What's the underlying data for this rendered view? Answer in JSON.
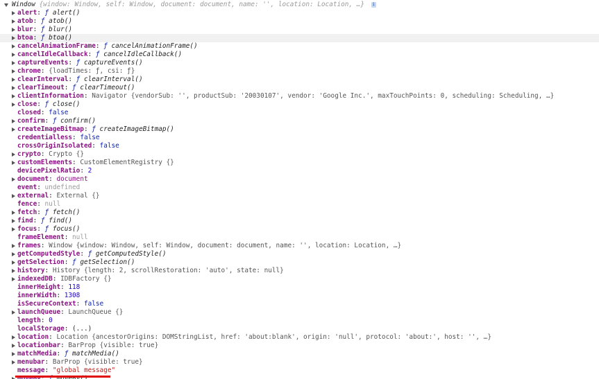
{
  "header": {
    "type": "Window",
    "preview": "{window: Window, self: Window, document: document, name: '', location: Location, …}",
    "info_icon": "i"
  },
  "properties": [
    {
      "key": "alert",
      "sep": ": ",
      "fk": "ƒ",
      "val": " alert()",
      "kind": "fn",
      "expand": true
    },
    {
      "key": "atob",
      "sep": ": ",
      "fk": "ƒ",
      "val": " atob()",
      "kind": "fn",
      "expand": true
    },
    {
      "key": "blur",
      "sep": ": ",
      "fk": "ƒ",
      "val": " blur()",
      "kind": "fn",
      "expand": true
    },
    {
      "key": "btoa",
      "sep": ": ",
      "fk": "ƒ",
      "val": " btoa()",
      "kind": "fn",
      "expand": true,
      "highlight": true
    },
    {
      "key": "cancelAnimationFrame",
      "sep": ": ",
      "fk": "ƒ",
      "val": " cancelAnimationFrame()",
      "kind": "fn",
      "expand": true
    },
    {
      "key": "cancelIdleCallback",
      "sep": ": ",
      "fk": "ƒ",
      "val": " cancelIdleCallback()",
      "kind": "fn",
      "expand": true
    },
    {
      "key": "captureEvents",
      "sep": ": ",
      "fk": "ƒ",
      "val": " captureEvents()",
      "kind": "fn",
      "expand": true
    },
    {
      "key": "chrome",
      "sep": ": ",
      "val": "{loadTimes: ƒ, csi: ƒ}",
      "kind": "obj",
      "expand": true
    },
    {
      "key": "clearInterval",
      "sep": ": ",
      "fk": "ƒ",
      "val": " clearInterval()",
      "kind": "fn",
      "expand": true
    },
    {
      "key": "clearTimeout",
      "sep": ": ",
      "fk": "ƒ",
      "val": " clearTimeout()",
      "kind": "fn",
      "expand": true
    },
    {
      "key": "clientInformation",
      "sep": ": ",
      "val": "Navigator {vendorSub: '', productSub: '20030107', vendor: 'Google Inc.', maxTouchPoints: 0, scheduling: Scheduling, …}",
      "kind": "obj",
      "expand": true
    },
    {
      "key": "close",
      "sep": ": ",
      "fk": "ƒ",
      "val": " close()",
      "kind": "fn",
      "expand": true
    },
    {
      "key": "closed",
      "sep": ": ",
      "val": "false",
      "kind": "bool",
      "expand": false
    },
    {
      "key": "confirm",
      "sep": ": ",
      "fk": "ƒ",
      "val": " confirm()",
      "kind": "fn",
      "expand": true
    },
    {
      "key": "createImageBitmap",
      "sep": ": ",
      "fk": "ƒ",
      "val": " createImageBitmap()",
      "kind": "fn",
      "expand": true
    },
    {
      "key": "credentialless",
      "sep": ": ",
      "val": "false",
      "kind": "bool",
      "expand": false
    },
    {
      "key": "crossOriginIsolated",
      "sep": ": ",
      "val": "false",
      "kind": "bool",
      "expand": false
    },
    {
      "key": "crypto",
      "sep": ": ",
      "val": "Crypto {}",
      "kind": "obj",
      "expand": true
    },
    {
      "key": "customElements",
      "sep": ": ",
      "val": "CustomElementRegistry {}",
      "kind": "obj",
      "expand": true
    },
    {
      "key": "devicePixelRatio",
      "sep": ": ",
      "val": "2",
      "kind": "num",
      "expand": false
    },
    {
      "key": "document",
      "sep": ": ",
      "val": "document",
      "kind": "docref",
      "expand": true
    },
    {
      "key": "event",
      "sep": ": ",
      "val": "undefined",
      "kind": "undef",
      "expand": false
    },
    {
      "key": "external",
      "sep": ": ",
      "val": "External {}",
      "kind": "obj",
      "expand": true
    },
    {
      "key": "fence",
      "sep": ": ",
      "val": "null",
      "kind": "undef",
      "expand": false
    },
    {
      "key": "fetch",
      "sep": ": ",
      "fk": "ƒ",
      "val": " fetch()",
      "kind": "fn",
      "expand": true
    },
    {
      "key": "find",
      "sep": ": ",
      "fk": "ƒ",
      "val": " find()",
      "kind": "fn",
      "expand": true
    },
    {
      "key": "focus",
      "sep": ": ",
      "fk": "ƒ",
      "val": " focus()",
      "kind": "fn",
      "expand": true
    },
    {
      "key": "frameElement",
      "sep": ": ",
      "val": "null",
      "kind": "undef",
      "expand": false
    },
    {
      "key": "frames",
      "sep": ": ",
      "val": "Window {window: Window, self: Window, document: document, name: '', location: Location, …}",
      "kind": "obj",
      "expand": true
    },
    {
      "key": "getComputedStyle",
      "sep": ": ",
      "fk": "ƒ",
      "val": " getComputedStyle()",
      "kind": "fn",
      "expand": true
    },
    {
      "key": "getSelection",
      "sep": ": ",
      "fk": "ƒ",
      "val": " getSelection()",
      "kind": "fn",
      "expand": true
    },
    {
      "key": "history",
      "sep": ": ",
      "val": "History {length: 2, scrollRestoration: 'auto', state: null}",
      "kind": "obj",
      "expand": true
    },
    {
      "key": "indexedDB",
      "sep": ": ",
      "val": "IDBFactory {}",
      "kind": "obj",
      "expand": true
    },
    {
      "key": "innerHeight",
      "sep": ": ",
      "val": "118",
      "kind": "num",
      "expand": false
    },
    {
      "key": "innerWidth",
      "sep": ": ",
      "val": "1308",
      "kind": "num",
      "expand": false
    },
    {
      "key": "isSecureContext",
      "sep": ": ",
      "val": "false",
      "kind": "bool",
      "expand": false
    },
    {
      "key": "launchQueue",
      "sep": ": ",
      "val": "LaunchQueue {}",
      "kind": "obj",
      "expand": true
    },
    {
      "key": "length",
      "sep": ": ",
      "val": "0",
      "kind": "num",
      "expand": false
    },
    {
      "key": "localStorage",
      "sep": ": ",
      "val": "(...)",
      "kind": "plain",
      "expand": false
    },
    {
      "key": "location",
      "sep": ": ",
      "val": "Location {ancestorOrigins: DOMStringList, href: 'about:blank', origin: 'null', protocol: 'about:', host: '', …}",
      "kind": "obj",
      "expand": true
    },
    {
      "key": "locationbar",
      "sep": ": ",
      "val": "BarProp {visible: true}",
      "kind": "obj",
      "expand": true
    },
    {
      "key": "matchMedia",
      "sep": ": ",
      "fk": "ƒ",
      "val": " matchMedia()",
      "kind": "fn",
      "expand": true
    },
    {
      "key": "menubar",
      "sep": ": ",
      "val": "BarProp {visible: true}",
      "kind": "obj",
      "expand": true
    },
    {
      "key": "message",
      "sep": ": ",
      "val": "\"global message\"",
      "kind": "str",
      "expand": false
    },
    {
      "key": "moveBy",
      "sep": ": ",
      "fk": "ƒ",
      "val": " moveBy()",
      "kind": "fn",
      "expand": true
    }
  ],
  "colors": {
    "key": "#881280",
    "string": "#c41a16",
    "number": "#1c00cf",
    "boolean": "#0d22aa",
    "muted": "#9a9a9a",
    "annotation_underline": "#e00000",
    "row_highlight": "#f1f1f1"
  }
}
